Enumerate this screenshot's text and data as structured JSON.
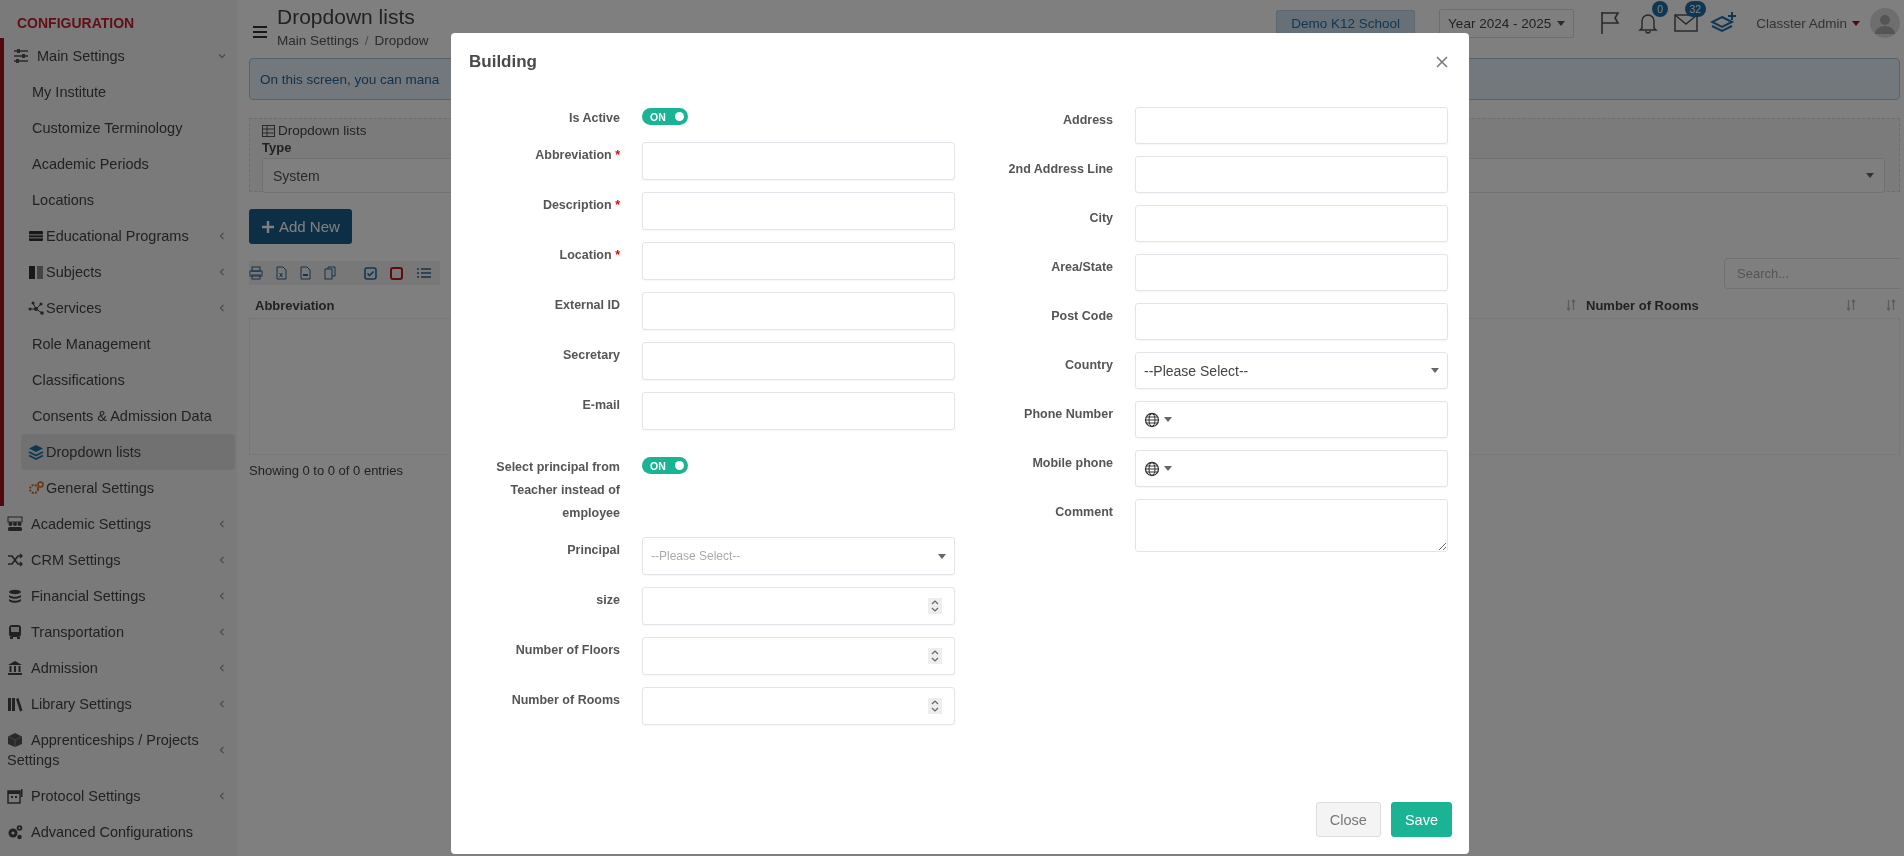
{
  "sidebar": {
    "title": "CONFIGURATION",
    "items": [
      {
        "label": "Main Settings",
        "expanded": true,
        "children": [
          {
            "label": "My Institute",
            "selected": false
          },
          {
            "label": "Customize Terminology",
            "selected": false
          },
          {
            "label": "Academic Periods",
            "selected": false
          },
          {
            "label": "Locations",
            "selected": false
          },
          {
            "label": "Educational Programs",
            "selected": false,
            "expanded": false
          },
          {
            "label": "Subjects",
            "selected": false,
            "expanded": false
          },
          {
            "label": "Services",
            "selected": false,
            "expanded": false
          },
          {
            "label": "Role Management",
            "selected": false
          },
          {
            "label": "Classifications",
            "selected": false
          },
          {
            "label": "Consents & Admission Data",
            "selected": false
          },
          {
            "label": "Dropdown lists",
            "selected": true
          },
          {
            "label": "General Settings",
            "selected": false
          }
        ]
      },
      {
        "label": "Academic Settings",
        "expanded": false
      },
      {
        "label": "CRM Settings",
        "expanded": false
      },
      {
        "label": "Financial Settings",
        "expanded": false
      },
      {
        "label": "Transportation",
        "expanded": false
      },
      {
        "label": "Admission",
        "expanded": false
      },
      {
        "label": "Library Settings",
        "expanded": false
      },
      {
        "label": "Apprenticeships / Projects Settings",
        "expanded": false
      },
      {
        "label": "Protocol Settings",
        "expanded": false
      },
      {
        "label": "Advanced Configurations"
      }
    ]
  },
  "header": {
    "title": "Dropdown lists",
    "breadcrumb": [
      "Main Settings",
      "Dropdow"
    ],
    "breadcrumb_separator": "/"
  },
  "top_bar": {
    "school": "Demo K12 School",
    "year": "Year 2024 - 2025",
    "notifications": "0",
    "messages": "32",
    "user": "Classter Admin"
  },
  "info": "On this screen, you can mana",
  "filter_panel": {
    "legend": "Dropdown lists",
    "type_label": "Type",
    "type_value": "System"
  },
  "add_button": "Add New",
  "table": {
    "search_placeholder": "Search...",
    "columns": [
      "Abbreviation",
      "Number of Rooms"
    ],
    "footer": "Showing 0 to 0 of 0 entries"
  },
  "modal": {
    "title": "Building",
    "left_fields": [
      {
        "label": "Is Active",
        "kind": "toggle",
        "on": true,
        "state_text": "ON"
      },
      {
        "label": "Abbreviation",
        "kind": "text",
        "required_mark": "*"
      },
      {
        "label": "Description",
        "kind": "text",
        "required_mark": "*"
      },
      {
        "label": "Location",
        "kind": "text",
        "required_mark": "*"
      },
      {
        "label": "External ID",
        "kind": "text"
      },
      {
        "label": "Secretary",
        "kind": "text"
      },
      {
        "label": "E-mail",
        "kind": "text"
      },
      {
        "label": "Select principal from Teacher instead of employee",
        "kind": "toggle",
        "on": true,
        "state_text": "ON"
      },
      {
        "label": "Principal",
        "kind": "select",
        "placeholder": "--Please Select--"
      },
      {
        "label": "size",
        "kind": "number"
      },
      {
        "label": "Number of Floors",
        "kind": "number"
      },
      {
        "label": "Number of Rooms",
        "kind": "number"
      }
    ],
    "right_fields": [
      {
        "label": "Address",
        "kind": "text"
      },
      {
        "label": "2nd Address Line",
        "kind": "text"
      },
      {
        "label": "City",
        "kind": "text"
      },
      {
        "label": "Area/State",
        "kind": "text"
      },
      {
        "label": "Post Code",
        "kind": "text"
      },
      {
        "label": "Country",
        "kind": "select",
        "value": "--Please Select--"
      },
      {
        "label": "Phone Number",
        "kind": "phone"
      },
      {
        "label": "Mobile phone",
        "kind": "phone"
      },
      {
        "label": "Comment",
        "kind": "textarea"
      }
    ],
    "buttons": [
      {
        "label": "Close",
        "kind": "secondary"
      },
      {
        "label": "Save",
        "kind": "primary"
      }
    ]
  }
}
